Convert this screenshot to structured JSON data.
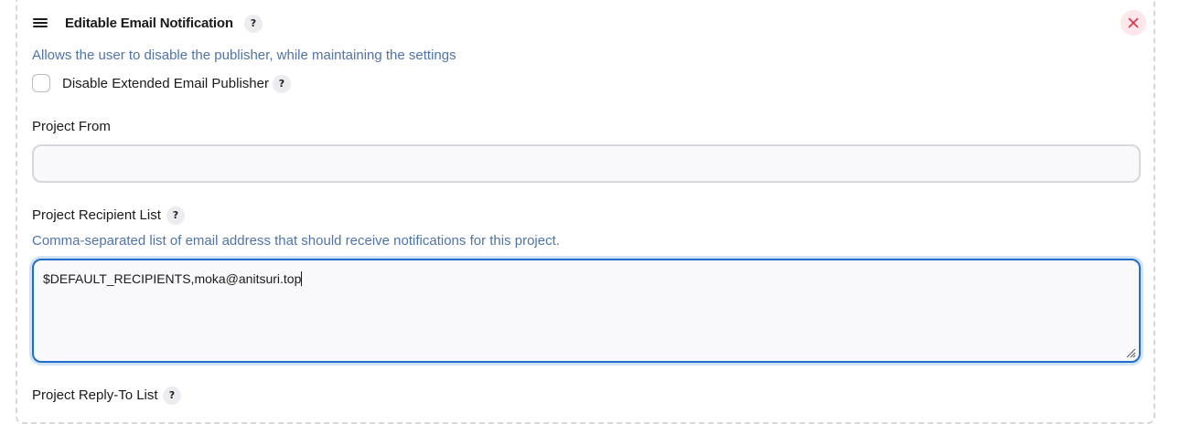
{
  "section": {
    "title": "Editable Email Notification",
    "help_symbol": "?"
  },
  "disable_publisher": {
    "description": "Allows the user to disable the publisher, while maintaining the settings",
    "label": "Disable Extended Email Publisher",
    "checked": false
  },
  "project_from": {
    "label": "Project From",
    "value": ""
  },
  "project_recipient_list": {
    "label": "Project Recipient List",
    "description": "Comma-separated list of email address that should receive notifications for this project.",
    "value": "$DEFAULT_RECIPIENTS,moka@anitsuri.top"
  },
  "project_reply_to_list": {
    "label": "Project Reply-To List"
  },
  "icons": {
    "drag": "drag-handle-icon",
    "close": "close-icon",
    "help": "help-icon",
    "resize": "resize-grip-icon"
  },
  "colors": {
    "accent": "#1f6fc9",
    "description_text": "#4f74a8",
    "close_icon": "#d9344a",
    "close_bg": "#fde7ea"
  }
}
